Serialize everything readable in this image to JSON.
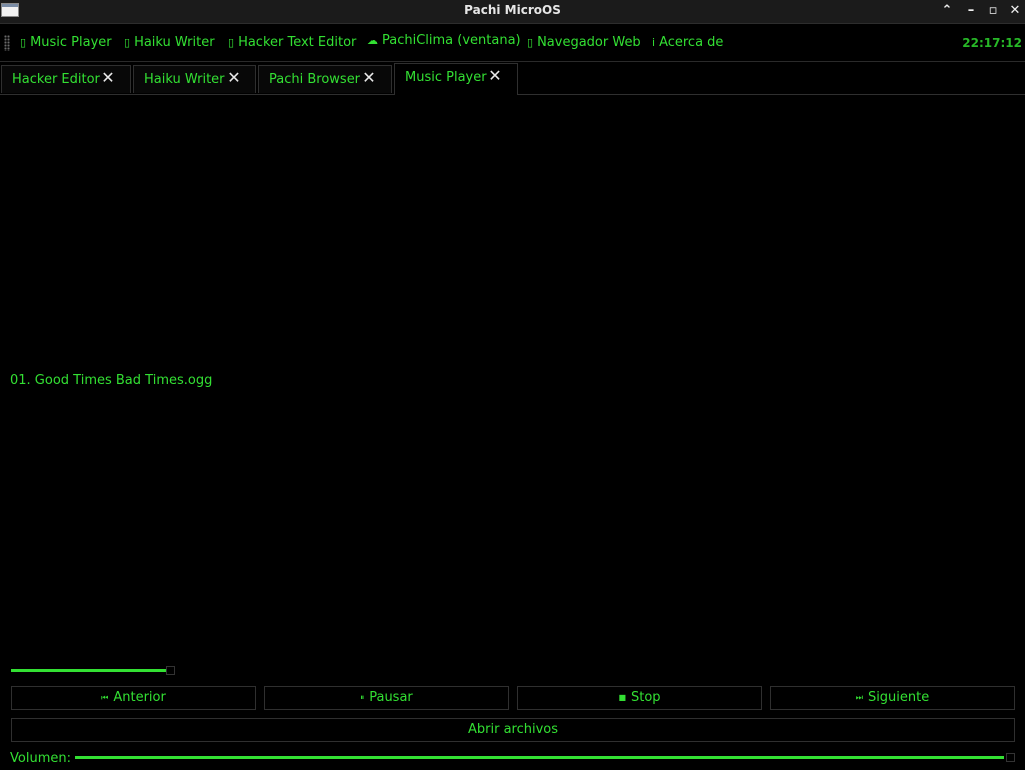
{
  "window": {
    "title": "Pachi MicroOS",
    "controls": {
      "maximize": "⌃",
      "minimize": "–",
      "restore": "▫",
      "close": "✕"
    }
  },
  "menubar": {
    "items": [
      {
        "icon": "music-icon",
        "glyph": "▯",
        "label": "Music Player"
      },
      {
        "icon": "haiku-icon",
        "glyph": "▯",
        "label": "Haiku Writer"
      },
      {
        "icon": "editor-icon",
        "glyph": "▯",
        "label": "Hacker Text Editor"
      },
      {
        "icon": "weather-icon",
        "glyph": "☁",
        "label": "PachiClima (ventana)"
      },
      {
        "icon": "browser-icon",
        "glyph": "▯",
        "label": "Navegador Web"
      },
      {
        "icon": "info-icon",
        "glyph": "i",
        "label": "Acerca de"
      }
    ],
    "clock": "22:17:12"
  },
  "tabs": [
    {
      "label": "Hacker Editor",
      "active": false
    },
    {
      "label": "Haiku Writer",
      "active": false
    },
    {
      "label": "Pachi Browser",
      "active": false
    },
    {
      "label": "Music Player",
      "active": true
    }
  ],
  "tab_close_glyph": "✕",
  "player": {
    "playlist": [
      "01. Good Times Bad Times.ogg"
    ],
    "progress_fraction": 0.96,
    "buttons": {
      "prev": {
        "glyph": "⏮",
        "label": "Anterior"
      },
      "pause": {
        "glyph": "⏸",
        "label": "Pausar"
      },
      "stop": {
        "glyph": "■",
        "label": "Stop"
      },
      "next": {
        "glyph": "⏭",
        "label": "Siguiente"
      }
    },
    "open_files": "Abrir archivos",
    "volume_label": "Volumen:",
    "volume_fraction": 1.0
  },
  "colors": {
    "accent": "#33e033",
    "background": "#000000",
    "titlebar": "#1b1b1b"
  }
}
